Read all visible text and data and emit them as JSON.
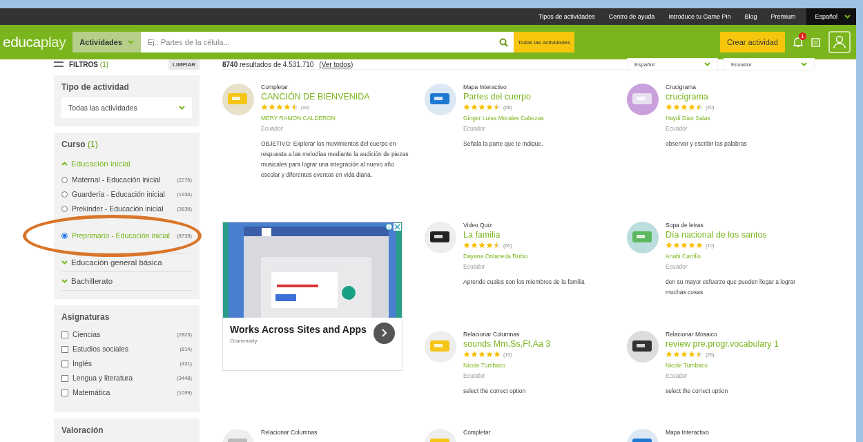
{
  "top_bar": {
    "links": [
      "Tipos de actividades",
      "Centro de ayuda",
      "Introduce tu Game Pin",
      "Blog",
      "Premium"
    ],
    "language": "Español"
  },
  "header": {
    "logo_a": "educa",
    "logo_b": "play",
    "category": "Actividades",
    "search": {
      "placeholder": "Ej.: Partes de la célula..."
    },
    "filter_button": "Todas las actividades",
    "create_button": "Crear actividad",
    "notifications": "1"
  },
  "filters_bar": {
    "title": "FILTROS",
    "count": "(1)",
    "clear": "LIMPIAR",
    "results": "**8740** resultados de 4.531.710",
    "view_all": "(Ver todos)",
    "language": "Español",
    "country": "Ecuador"
  },
  "sidebar": {
    "activity_type": {
      "title": "Tipo de actividad",
      "value": "Todas las actividades"
    },
    "course": {
      "title": "Curso",
      "count": "(1)",
      "groups": [
        {
          "label": "Educación inicial",
          "expanded": true,
          "children": [
            {
              "label": "Maternal - Educación inicial",
              "count": "(2276)",
              "selected": false
            },
            {
              "label": "Guardería - Educación inicial",
              "count": "(1936)",
              "selected": false
            },
            {
              "label": "Prekinder - Educación inicial",
              "count": "(3636)",
              "selected": false
            },
            {
              "label": "Preprimario - Educación inicial",
              "count": "(8738)",
              "selected": true
            }
          ]
        },
        {
          "label": "Educación general básica",
          "expanded": false
        },
        {
          "label": "Bachillerato",
          "expanded": false
        }
      ]
    },
    "subjects": {
      "title": "Asignaturas",
      "items": [
        {
          "label": "Ciencias",
          "count": "(2823)",
          "checked": false
        },
        {
          "label": "Estudios sociales",
          "count": "(814)",
          "checked": false
        },
        {
          "label": "Inglés",
          "count": "(431)",
          "checked": false
        },
        {
          "label": "Lengua y literatura",
          "count": "(3448)",
          "checked": false
        },
        {
          "label": "Matemática",
          "count": "(1099)",
          "checked": false
        }
      ]
    },
    "rating": {
      "title": "Valoración"
    }
  },
  "results": [
    {
      "kind": "activity",
      "type": "Completar",
      "title": "CANCIÓN DE BIENVENIDA",
      "stars": 4.5,
      "reviews": "(44)",
      "author": "MERY RAMON CALDERON",
      "country": "Ecuador",
      "description": "OBJETIVO: Explorar los movimientos del cuerpo en respuesta a las melodías mediante la audición de piezas musicales para lograr una integración al nuevo año escolar y diferentes eventos en vida diaria."
    },
    {
      "kind": "activity",
      "type": "Mapa Interactivo",
      "title": "Partes del cuerpo",
      "stars": 4.5,
      "reviews": "(68)",
      "author": "Ginger Luisa Morales Cabezas",
      "country": "Ecuador",
      "description": "Señala la parte que te indique."
    },
    {
      "kind": "activity",
      "type": "Crucigrama",
      "title": "crucigrama",
      "stars": 4.5,
      "reviews": "(40)",
      "author": "Haydi Diaz Salas",
      "country": "Ecuador",
      "description": "observar y escribir las palabras"
    },
    {
      "kind": "ad",
      "headline": "Works Across Sites and Apps",
      "advertiser": "Grammarly"
    },
    {
      "kind": "activity",
      "type": "Video Quiz",
      "title": "La familia",
      "stars": 4.5,
      "reviews": "(60)",
      "author": "Dayana Ontaneda Rubio",
      "country": "Ecuador",
      "description": "Aprende cuales son los miembros de la familia"
    },
    {
      "kind": "activity",
      "type": "Sopa de letras",
      "title": "Día nacional de los santos",
      "stars": 5,
      "reviews": "(10)",
      "author": "Anahi Carrillo",
      "country": "Ecuador",
      "description": "den su mayor esfuerzo que pueden llegar a lograr muchas cosas"
    },
    {
      "kind": "activity",
      "type": "Relacionar Columnas",
      "title": "sounds Mm,Ss,Ff,Aa 3",
      "stars": 5,
      "reviews": "(10)",
      "author": "Nicole Tumbaco",
      "country": "Ecuador",
      "description": "select the correct option"
    },
    {
      "kind": "activity",
      "type": "Relacionar Mosaico",
      "title": "review pre.progr.vocabulary 1",
      "stars": 4.5,
      "reviews": "(26)",
      "author": "Nicole Tumbaco",
      "country": "Ecuador",
      "description": "select the correct option"
    },
    {
      "kind": "partial",
      "type": "Relacionar Columnas"
    },
    {
      "kind": "partial",
      "type": "Completar"
    },
    {
      "kind": "partial",
      "type": "Mapa Interactivo"
    }
  ]
}
